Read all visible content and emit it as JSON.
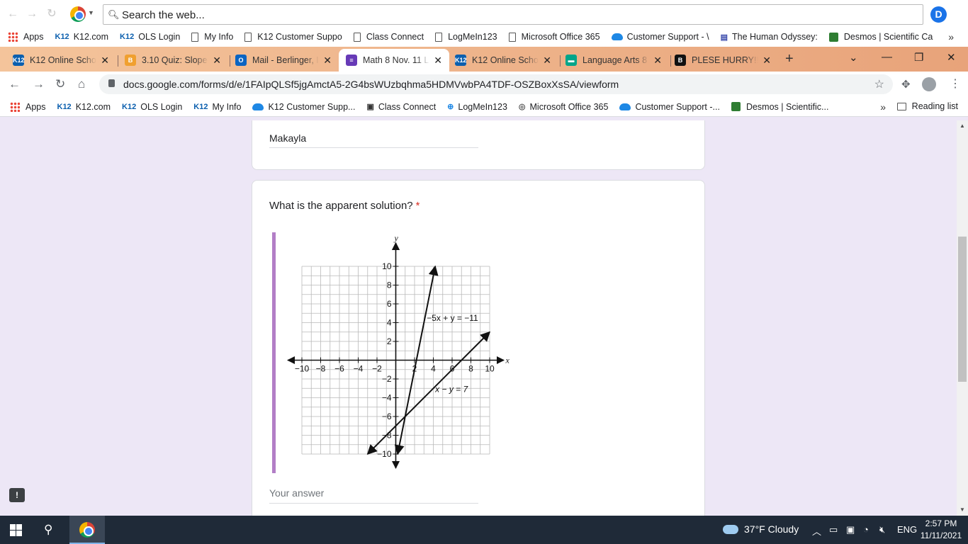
{
  "outer_toolbar": {
    "search_placeholder": "Search the web...",
    "profile_letter": "D"
  },
  "outer_bookmarks": [
    {
      "label": "Apps",
      "icon": "apps-grid-icon"
    },
    {
      "label": "K12.com",
      "icon": "k12-icon"
    },
    {
      "label": "OLS Login",
      "icon": "k12-icon"
    },
    {
      "label": "My Info",
      "icon": "page-icon"
    },
    {
      "label": "K12 Customer Suppo",
      "icon": "page-icon"
    },
    {
      "label": "Class Connect",
      "icon": "page-icon"
    },
    {
      "label": "LogMeIn123",
      "icon": "page-icon"
    },
    {
      "label": "Microsoft Office 365",
      "icon": "page-icon"
    },
    {
      "label": "Customer Support - \\",
      "icon": "salesforce-cloud-icon"
    },
    {
      "label": "The Human Odyssey:",
      "icon": "book-icon"
    },
    {
      "label": "Desmos | Scientific Ca",
      "icon": "desmos-icon"
    }
  ],
  "tabs": [
    {
      "label": "K12 Online Schoo",
      "icon": "K12",
      "color": "#0b5fae",
      "active": false
    },
    {
      "label": "3.10 Quiz: Slope-",
      "icon": "B",
      "color": "#f0a030",
      "active": false
    },
    {
      "label": "Mail - Berlinger, I",
      "icon": "O",
      "color": "#0a64c2",
      "active": false
    },
    {
      "label": "Math 8 Nov. 11 L",
      "icon": "≡",
      "color": "#673ab7",
      "active": true
    },
    {
      "label": "K12 Online Schoo",
      "icon": "K12",
      "color": "#0b5fae",
      "active": false
    },
    {
      "label": "Language Arts 8",
      "icon": "▬",
      "color": "#00a58a",
      "active": false
    },
    {
      "label": "PLESE HURRY!!! ",
      "icon": "B",
      "color": "#111111",
      "active": false
    }
  ],
  "address": {
    "url": "docs.google.com/forms/d/e/1FAIpQLSf5jgAmctA5-2G4bsWUzbqhma5HDMVwbPA4TDF-OSZBoxXsSA/viewform"
  },
  "inner_bookmarks": [
    {
      "label": "Apps",
      "icon": "apps-grid-icon"
    },
    {
      "label": "K12.com",
      "icon": "k12-icon"
    },
    {
      "label": "OLS Login",
      "icon": "k12-icon"
    },
    {
      "label": "My Info",
      "icon": "k12-icon"
    },
    {
      "label": "K12 Customer Supp...",
      "icon": "salesforce-cloud-icon"
    },
    {
      "label": "Class Connect",
      "icon": "class-connect-icon"
    },
    {
      "label": "LogMeIn123",
      "icon": "plus-circle-icon"
    },
    {
      "label": "Microsoft Office 365",
      "icon": "office-icon"
    },
    {
      "label": "Customer Support -...",
      "icon": "salesforce-cloud-icon"
    },
    {
      "label": "Desmos | Scientific...",
      "icon": "desmos-icon"
    }
  ],
  "reading_list": "Reading list",
  "form": {
    "previous_answer": "Makayla",
    "question": "What is the apparent solution?",
    "required_mark": "*",
    "answer_placeholder": "Your answer"
  },
  "graph": {
    "x_axis_label": "x",
    "y_axis_label": "y",
    "x_ticks": [
      "−10",
      "−8",
      "−6",
      "−4",
      "−2",
      "2",
      "4",
      "6",
      "8",
      "10"
    ],
    "y_ticks": [
      "10",
      "8",
      "6",
      "4",
      "2",
      "−2",
      "−4",
      "−6",
      "−8",
      "−10"
    ],
    "line1_label": "−5x + y = −11",
    "line2_label": "x − y = 7",
    "line1": {
      "from": [
        0.2,
        -10
      ],
      "to": [
        4.2,
        10
      ]
    },
    "line2": {
      "from": [
        -3,
        -10
      ],
      "to": [
        10,
        3
      ]
    }
  },
  "taskbar": {
    "weather": "37°F  Cloudy",
    "language": "ENG",
    "time": "2:57 PM",
    "date": "11/11/2021"
  }
}
